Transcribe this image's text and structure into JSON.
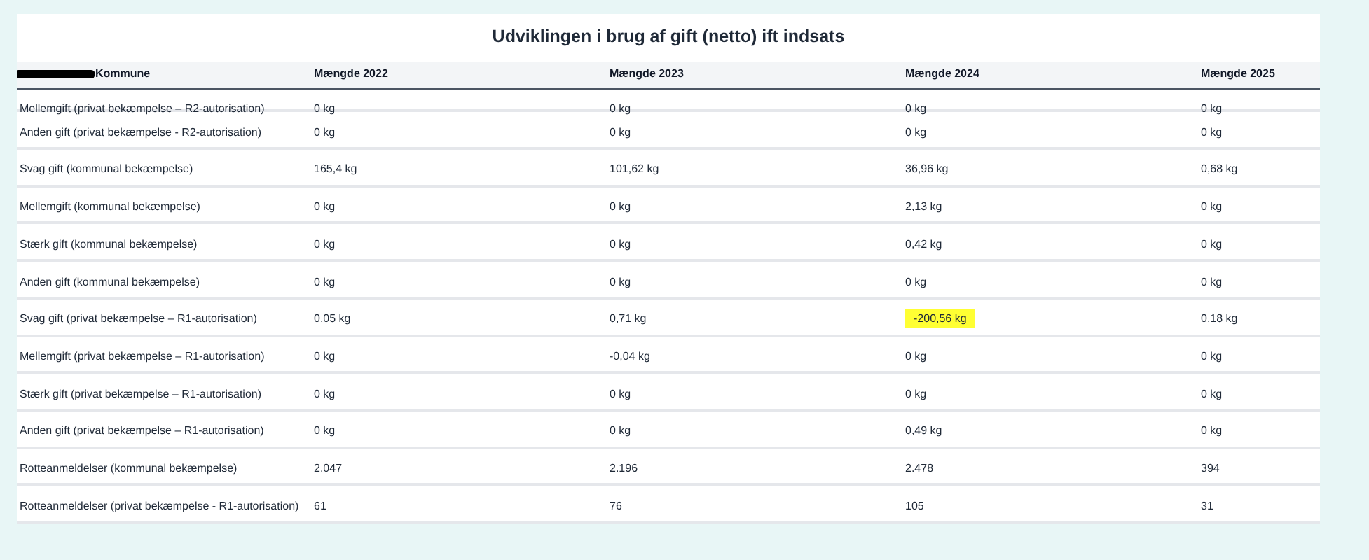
{
  "title": "Udviklingen i brug af gift (netto) ift indsats",
  "table": {
    "columns": [
      {
        "label": "Kommune",
        "redacted": true
      },
      {
        "label": "Mængde 2022",
        "redacted": false
      },
      {
        "label": "Mængde 2023",
        "redacted": false
      },
      {
        "label": "Mængde 2024",
        "redacted": false
      },
      {
        "label": "Mængde 2025",
        "redacted": false
      }
    ],
    "rows": [
      {
        "cells": [
          {
            "text": "Mellemgift (privat bekæmpelse – R2-autorisation)",
            "highlighted": false
          },
          {
            "text": "0 kg",
            "highlighted": false
          },
          {
            "text": "0 kg",
            "highlighted": false
          },
          {
            "text": "0 kg",
            "highlighted": false
          },
          {
            "text": "0 kg",
            "highlighted": false
          }
        ]
      },
      {
        "cells": [
          {
            "text": "Anden gift (privat bekæmpelse - R2-autorisation)",
            "highlighted": false
          },
          {
            "text": "0 kg",
            "highlighted": false
          },
          {
            "text": "0 kg",
            "highlighted": false
          },
          {
            "text": "0 kg",
            "highlighted": false
          },
          {
            "text": "0 kg",
            "highlighted": false
          }
        ]
      },
      {
        "cells": [
          {
            "text": "Svag gift (kommunal bekæmpelse)",
            "highlighted": false
          },
          {
            "text": "165,4 kg",
            "highlighted": false
          },
          {
            "text": "101,62 kg",
            "highlighted": false
          },
          {
            "text": "36,96 kg",
            "highlighted": false
          },
          {
            "text": "0,68 kg",
            "highlighted": false
          }
        ]
      },
      {
        "cells": [
          {
            "text": "Mellemgift (kommunal bekæmpelse)",
            "highlighted": false
          },
          {
            "text": "0 kg",
            "highlighted": false
          },
          {
            "text": "0 kg",
            "highlighted": false
          },
          {
            "text": "2,13 kg",
            "highlighted": false
          },
          {
            "text": "0 kg",
            "highlighted": false
          }
        ]
      },
      {
        "cells": [
          {
            "text": "Stærk gift (kommunal bekæmpelse)",
            "highlighted": false
          },
          {
            "text": "0 kg",
            "highlighted": false
          },
          {
            "text": "0 kg",
            "highlighted": false
          },
          {
            "text": "0,42 kg",
            "highlighted": false
          },
          {
            "text": "0 kg",
            "highlighted": false
          }
        ]
      },
      {
        "cells": [
          {
            "text": "Anden gift (kommunal bekæmpelse)",
            "highlighted": false
          },
          {
            "text": "0 kg",
            "highlighted": false
          },
          {
            "text": "0 kg",
            "highlighted": false
          },
          {
            "text": "0 kg",
            "highlighted": false
          },
          {
            "text": "0 kg",
            "highlighted": false
          }
        ]
      },
      {
        "cells": [
          {
            "text": "Svag gift (privat bekæmpelse – R1-autorisation)",
            "highlighted": false
          },
          {
            "text": "0,05 kg",
            "highlighted": false
          },
          {
            "text": "0,71 kg",
            "highlighted": false
          },
          {
            "text": "-200,56 kg",
            "highlighted": true
          },
          {
            "text": "0,18 kg",
            "highlighted": false
          }
        ]
      },
      {
        "cells": [
          {
            "text": "Mellemgift (privat bekæmpelse – R1-autorisation)",
            "highlighted": false
          },
          {
            "text": "0 kg",
            "highlighted": false
          },
          {
            "text": "-0,04 kg",
            "highlighted": false
          },
          {
            "text": "0 kg",
            "highlighted": false
          },
          {
            "text": "0 kg",
            "highlighted": false
          }
        ]
      },
      {
        "cells": [
          {
            "text": "Stærk gift (privat bekæmpelse – R1-autorisation)",
            "highlighted": false
          },
          {
            "text": "0 kg",
            "highlighted": false
          },
          {
            "text": "0 kg",
            "highlighted": false
          },
          {
            "text": "0 kg",
            "highlighted": false
          },
          {
            "text": "0 kg",
            "highlighted": false
          }
        ]
      },
      {
        "cells": [
          {
            "text": "Anden gift (privat bekæmpelse – R1-autorisation)",
            "highlighted": false
          },
          {
            "text": "0 kg",
            "highlighted": false
          },
          {
            "text": "0 kg",
            "highlighted": false
          },
          {
            "text": "0,49 kg",
            "highlighted": false
          },
          {
            "text": "0 kg",
            "highlighted": false
          }
        ]
      },
      {
        "cells": [
          {
            "text": "Rotteanmeldelser (kommunal bekæmpelse)",
            "highlighted": false
          },
          {
            "text": "2.047",
            "highlighted": false
          },
          {
            "text": "2.196",
            "highlighted": false
          },
          {
            "text": "2.478",
            "highlighted": false
          },
          {
            "text": "394",
            "highlighted": false
          }
        ]
      },
      {
        "cells": [
          {
            "text": "Rotteanmeldelser (privat bekæmpelse - R1-autorisation)",
            "highlighted": false
          },
          {
            "text": "61",
            "highlighted": false
          },
          {
            "text": "76",
            "highlighted": false
          },
          {
            "text": "105",
            "highlighted": false
          },
          {
            "text": "31",
            "highlighted": false
          }
        ]
      }
    ]
  }
}
